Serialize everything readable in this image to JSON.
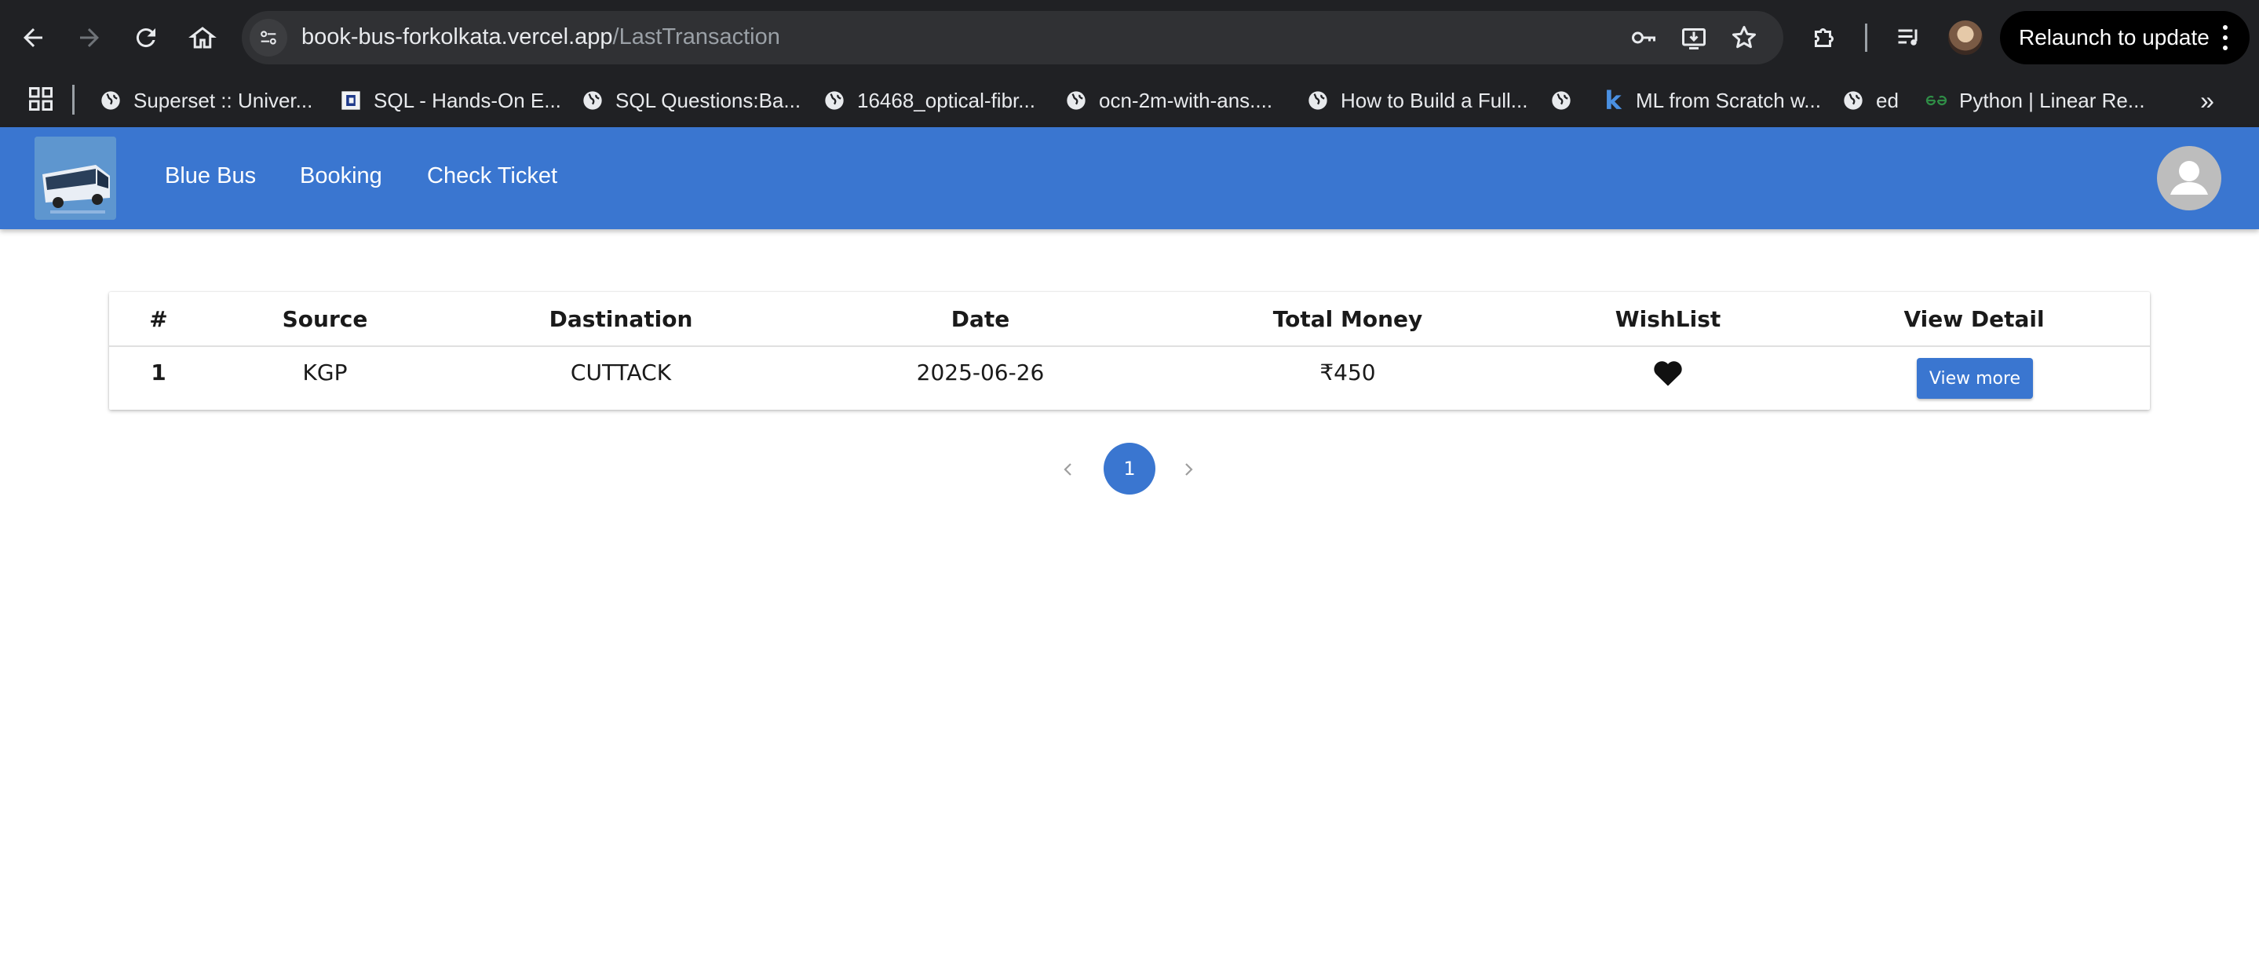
{
  "browser": {
    "url_host": "book-bus-forkolkata.vercel.app",
    "url_path": "/LastTransaction",
    "relaunch_label": "Relaunch to update"
  },
  "bookmarks": [
    {
      "label": "Superset :: Univer...",
      "icon": "globe-icon"
    },
    {
      "label": "SQL - Hands-On E...",
      "icon": "site-favicon"
    },
    {
      "label": "SQL Questions:Ba...",
      "icon": "globe-icon"
    },
    {
      "label": "16468_optical-fibr...",
      "icon": "globe-icon"
    },
    {
      "label": "ocn-2m-with-ans....",
      "icon": "globe-icon"
    },
    {
      "label": "How to Build a Full...",
      "icon": "globe-icon"
    },
    {
      "label": "",
      "icon": "globe-icon"
    },
    {
      "label": "ML from Scratch w...",
      "icon": "k-icon"
    },
    {
      "label": "ed",
      "icon": "globe-icon"
    },
    {
      "label": "Python | Linear Re...",
      "icon": "gfg-icon"
    }
  ],
  "app_nav": {
    "links": [
      "Blue Bus",
      "Booking",
      "Check Ticket"
    ]
  },
  "table": {
    "headers": [
      "#",
      "Source",
      "Dastination",
      "Date",
      "Total Money",
      "WishList",
      "View Detail"
    ],
    "rows": [
      {
        "index": "1",
        "source": "KGP",
        "destination": "CUTTACK",
        "date": "2025-06-26",
        "total": "₹450",
        "wishlisted": true,
        "action_label": "View more"
      }
    ]
  },
  "pagination": {
    "current_page": "1"
  },
  "colors": {
    "accent": "#3a76d0",
    "chrome": "#202124"
  }
}
